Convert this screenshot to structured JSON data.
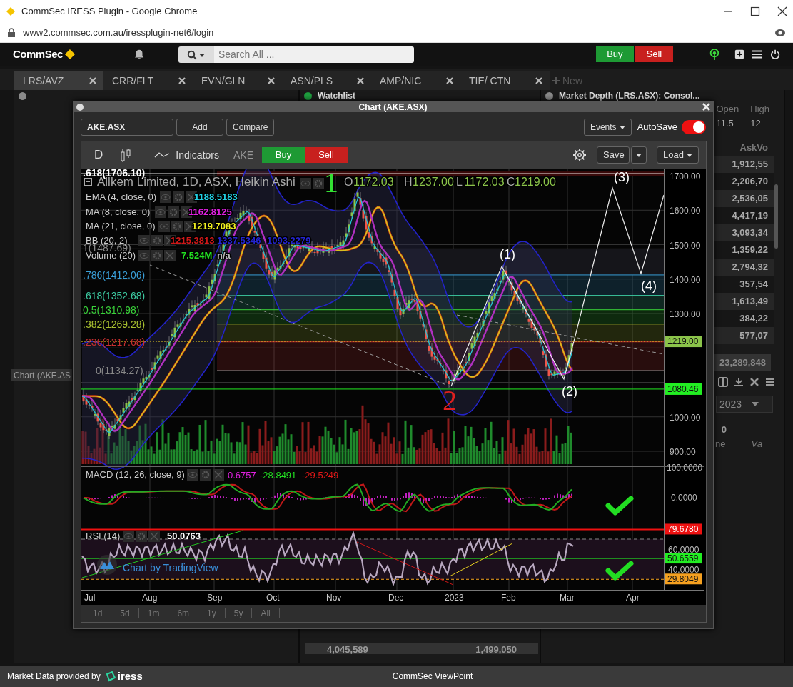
{
  "browser": {
    "title": "CommSec IRESS Plugin - Google Chrome",
    "url": "www2.commsec.com.au/iressplugin-net6/login"
  },
  "app_bar": {
    "logo": "CommSec",
    "search_placeholder": "Search All ...",
    "buy": "Buy",
    "sell": "Sell"
  },
  "tabs": [
    {
      "label": "LRS/AVZ",
      "selected": true
    },
    {
      "label": "CRR/FLT",
      "selected": false
    },
    {
      "label": "EVN/GLN",
      "selected": false
    },
    {
      "label": "ASN/PLS",
      "selected": false
    },
    {
      "label": "AMP/NIC",
      "selected": false
    },
    {
      "label": "TIE/ CTN",
      "selected": false
    }
  ],
  "new_tab": "New",
  "panels": [
    {
      "color": "#8a8a8a"
    },
    {
      "title": "Watchlist",
      "color": "#1e9e3e"
    },
    {
      "title": "Market Depth (LRS.ASX): Consol...",
      "color": "#8a8a8a"
    }
  ],
  "minimized_window": "Chart (AKE.AS",
  "depth": {
    "open_label": "Open",
    "open": "11.5",
    "high_label": "High",
    "high": "12",
    "ask_header": "AskVo",
    "ask_volumes": [
      "1,912,55",
      "2,206,70",
      "2,536,05",
      "4,417,19",
      "3,093,34",
      "1,359,22",
      "2,794,32",
      "357,54",
      "1,613,49",
      "384,22",
      "577,07"
    ],
    "total": "23,289,848",
    "date_value": "2023",
    "count": "0",
    "column_a": "ne",
    "column_b": "Va"
  },
  "watchlist_totals": [
    "4,045,589",
    "1,499,050"
  ],
  "chart_window": {
    "title": "Chart (AKE.ASX)",
    "symbol": "AKE.ASX",
    "add": "Add",
    "compare": "Compare",
    "events": "Events",
    "autosave": {
      "label": "AutoSave",
      "on": true
    },
    "toolbar": {
      "interval": "D",
      "indicators": "Indicators",
      "ticker": "AKE",
      "buy": "Buy",
      "sell": "Sell",
      "save": "Save",
      "load": "Load"
    },
    "header": {
      "name": "Allkem Limited, 1D, ASX, Heikin Ashi",
      "ohlc": [
        {
          "label": "O",
          "value": "1172.03"
        },
        {
          "label": "H",
          "value": "1237.00"
        },
        {
          "label": "L",
          "value": "1172.03"
        },
        {
          "label": "C",
          "value": "1219.00"
        }
      ]
    },
    "legend": [
      {
        "label": "EMA (4, close, 0)",
        "values": [
          {
            "text": "1188.5183",
            "color": "#22d3e6"
          }
        ]
      },
      {
        "label": "MA (8, close, 0)",
        "values": [
          {
            "text": "1162.8125",
            "color": "#e020e0"
          }
        ]
      },
      {
        "label": "MA (21, close, 0)",
        "values": [
          {
            "text": "1219.7083",
            "color": "#f0f020"
          }
        ]
      },
      {
        "label": "BB (20, 2)",
        "values": [
          {
            "text": "1215.3813",
            "color": "#d01818"
          },
          {
            "text": "1337.5346",
            "color": "#2424d0"
          },
          {
            "text": "1093.2279",
            "color": "#2424d0"
          }
        ]
      },
      {
        "label": "Volume (20)",
        "values": [
          {
            "text": "7.524M",
            "color": "#22e022"
          },
          {
            "text": "n/a",
            "color": "#bbbbbb"
          }
        ]
      }
    ],
    "fib_levels": [
      {
        "label": ".618(1706.10)",
        "color": "#ffffff"
      },
      {
        "label": "1(1487.69)",
        "color": "#888888"
      },
      {
        "label": ".786(1412.06)",
        "color": "#3a9fd8"
      },
      {
        "label": ".618(1352.68)",
        "color": "#3cc8a0"
      },
      {
        "label": "0.5(1310.98)",
        "color": "#3ad23a"
      },
      {
        "label": ".382(1269.28)",
        "color": "#a8c030"
      },
      {
        "label": ".236(1217.68)",
        "color": "#c83030"
      },
      {
        "label": "0(1134.27)",
        "color": "#888888"
      }
    ],
    "wave_labels": [
      {
        "text": "1",
        "kind": "major",
        "color": "#33e033"
      },
      {
        "text": "2",
        "kind": "major",
        "color": "#e02020"
      },
      {
        "text": "(1)",
        "kind": "minor",
        "color": "#ffffff"
      },
      {
        "text": "(2)",
        "kind": "minor",
        "color": "#ffffff"
      },
      {
        "text": "(3)",
        "kind": "minor",
        "color": "#ffffff"
      },
      {
        "text": "(4)",
        "kind": "minor",
        "color": "#ffffff"
      }
    ],
    "price_axis": [
      "1700.00",
      "1600.00",
      "1500.00",
      "1400.00",
      "1300.00",
      "1000.00",
      "900.00"
    ],
    "price_tags": [
      {
        "text": "1219.00",
        "color": "#8bc34a"
      },
      {
        "text": "1080.46",
        "color": "#22ee22"
      }
    ],
    "macd": {
      "label": "MACD (12, 26, close, 9)",
      "values": [
        {
          "text": "0.6757",
          "color": "#e020e0"
        },
        {
          "text": "-28.8491",
          "color": "#22dd22"
        },
        {
          "text": "-29.5249",
          "color": "#e01818"
        }
      ],
      "axis": [
        "100.0000",
        "0.0000"
      ]
    },
    "rsi": {
      "label": "RSI (14)",
      "value": "50.0763",
      "axis": [
        "60.0000",
        "40.0000"
      ],
      "tags": [
        {
          "text": "79.6780",
          "color": "#ee1111"
        },
        {
          "text": "50.6559",
          "color": "#22ee22"
        },
        {
          "text": "29.8049",
          "color": "#f5a020"
        }
      ]
    },
    "attribution": "Chart by TradingView",
    "x_axis": [
      "Jul",
      "Aug",
      "Sep",
      "Oct",
      "Nov",
      "Dec",
      "2023",
      "Feb",
      "Mar",
      "Apr"
    ],
    "ranges": [
      "1d",
      "5d",
      "1m",
      "6m",
      "1y",
      "5y",
      "All"
    ]
  },
  "footer": {
    "provider": "Market Data provided by",
    "provider_logo": "iress",
    "center": "CommSec ViewPoint"
  }
}
